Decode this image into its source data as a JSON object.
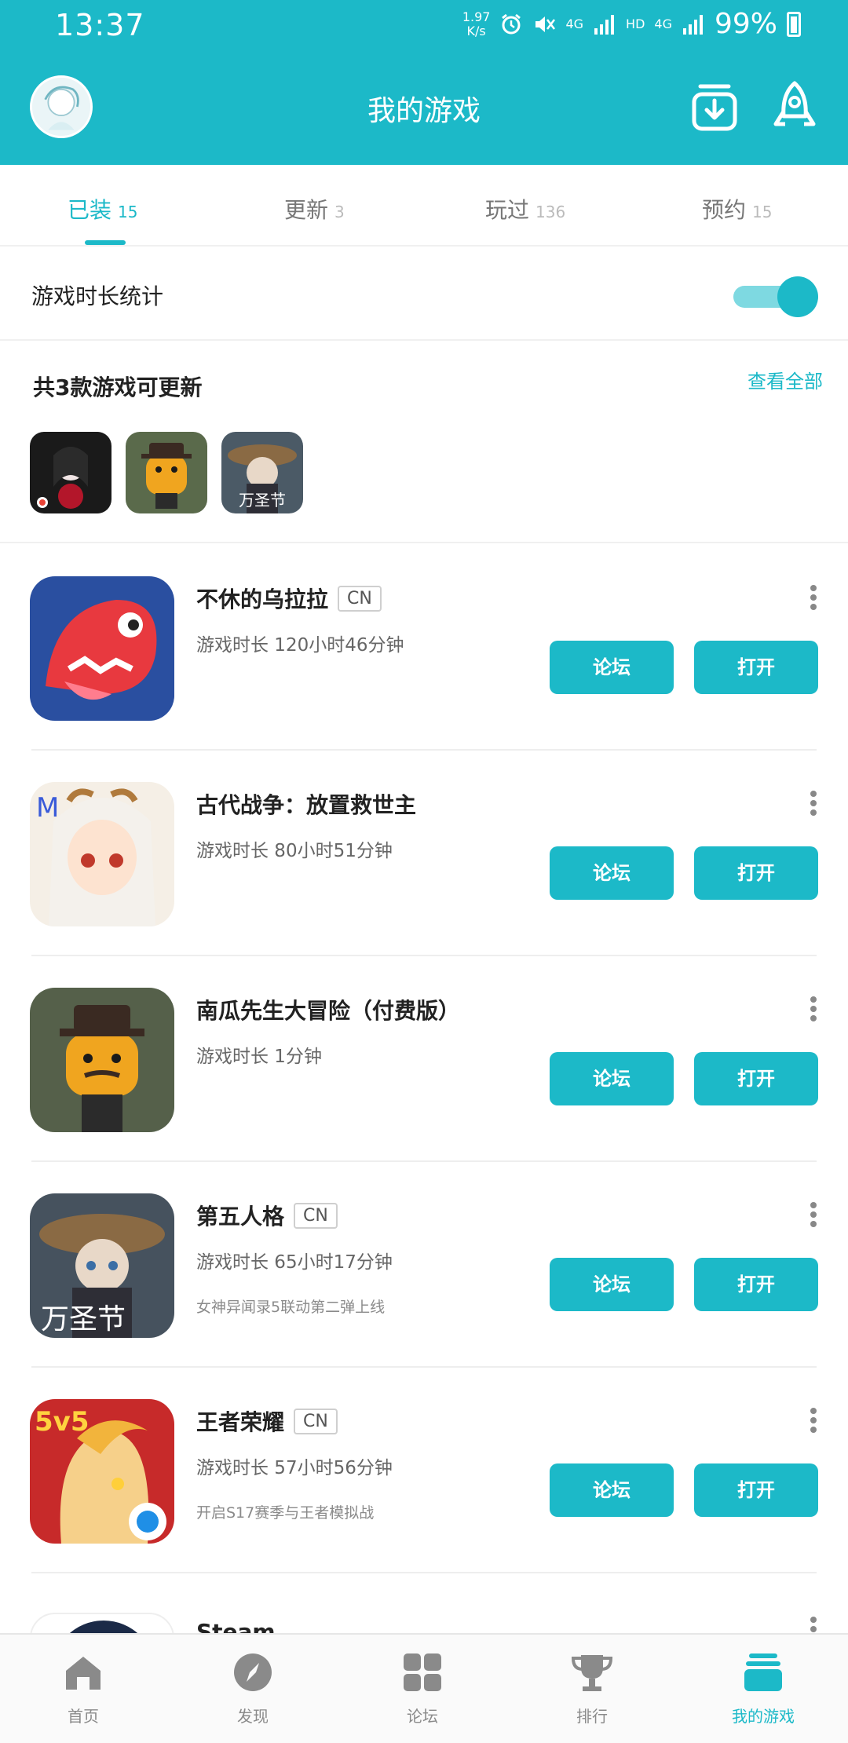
{
  "status_bar": {
    "time": "13:37",
    "net_speed_value": "1.97",
    "net_speed_unit": "K/s",
    "net1": "4G",
    "hd": "HD",
    "net2": "4G",
    "battery": "99%"
  },
  "header": {
    "title": "我的游戏"
  },
  "tabs": [
    {
      "label": "已装",
      "count": "15"
    },
    {
      "label": "更新",
      "count": "3"
    },
    {
      "label": "玩过",
      "count": "136"
    },
    {
      "label": "预约",
      "count": "15"
    }
  ],
  "stats": {
    "label": "游戏时长统计",
    "toggle_on": true
  },
  "updates": {
    "label": "共3款游戏可更新",
    "view_all": "查看全部",
    "thumb3_caption": "万圣节"
  },
  "games": [
    {
      "name": "不休的乌拉拉",
      "tag": "CN",
      "playtime": "游戏时长 120小时46分钟",
      "desc": "",
      "forum": "论坛",
      "open": "打开"
    },
    {
      "name": "古代战争：放置救世主",
      "tag": "",
      "playtime": "游戏时长 80小时51分钟",
      "desc": "",
      "forum": "论坛",
      "open": "打开"
    },
    {
      "name": "南瓜先生大冒险（付费版）",
      "tag": "",
      "playtime": "游戏时长 1分钟",
      "desc": "",
      "forum": "论坛",
      "open": "打开"
    },
    {
      "name": "第五人格",
      "tag": "CN",
      "playtime": "游戏时长 65小时17分钟",
      "desc": "女神异闻录5联动第二弹上线",
      "forum": "论坛",
      "open": "打开",
      "icon_caption": "万圣节"
    },
    {
      "name": "王者荣耀",
      "tag": "CN",
      "playtime": "游戏时长 57小时56分钟",
      "desc": "开启S17赛季与王者模拟战",
      "forum": "论坛",
      "open": "打开",
      "icon_caption": "5v5"
    }
  ],
  "steam": {
    "name": "Steam"
  },
  "bottom_nav": [
    {
      "label": "首页"
    },
    {
      "label": "发现"
    },
    {
      "label": "论坛"
    },
    {
      "label": "排行"
    },
    {
      "label": "我的游戏"
    }
  ],
  "colors": {
    "accent": "#1CB9C8"
  }
}
